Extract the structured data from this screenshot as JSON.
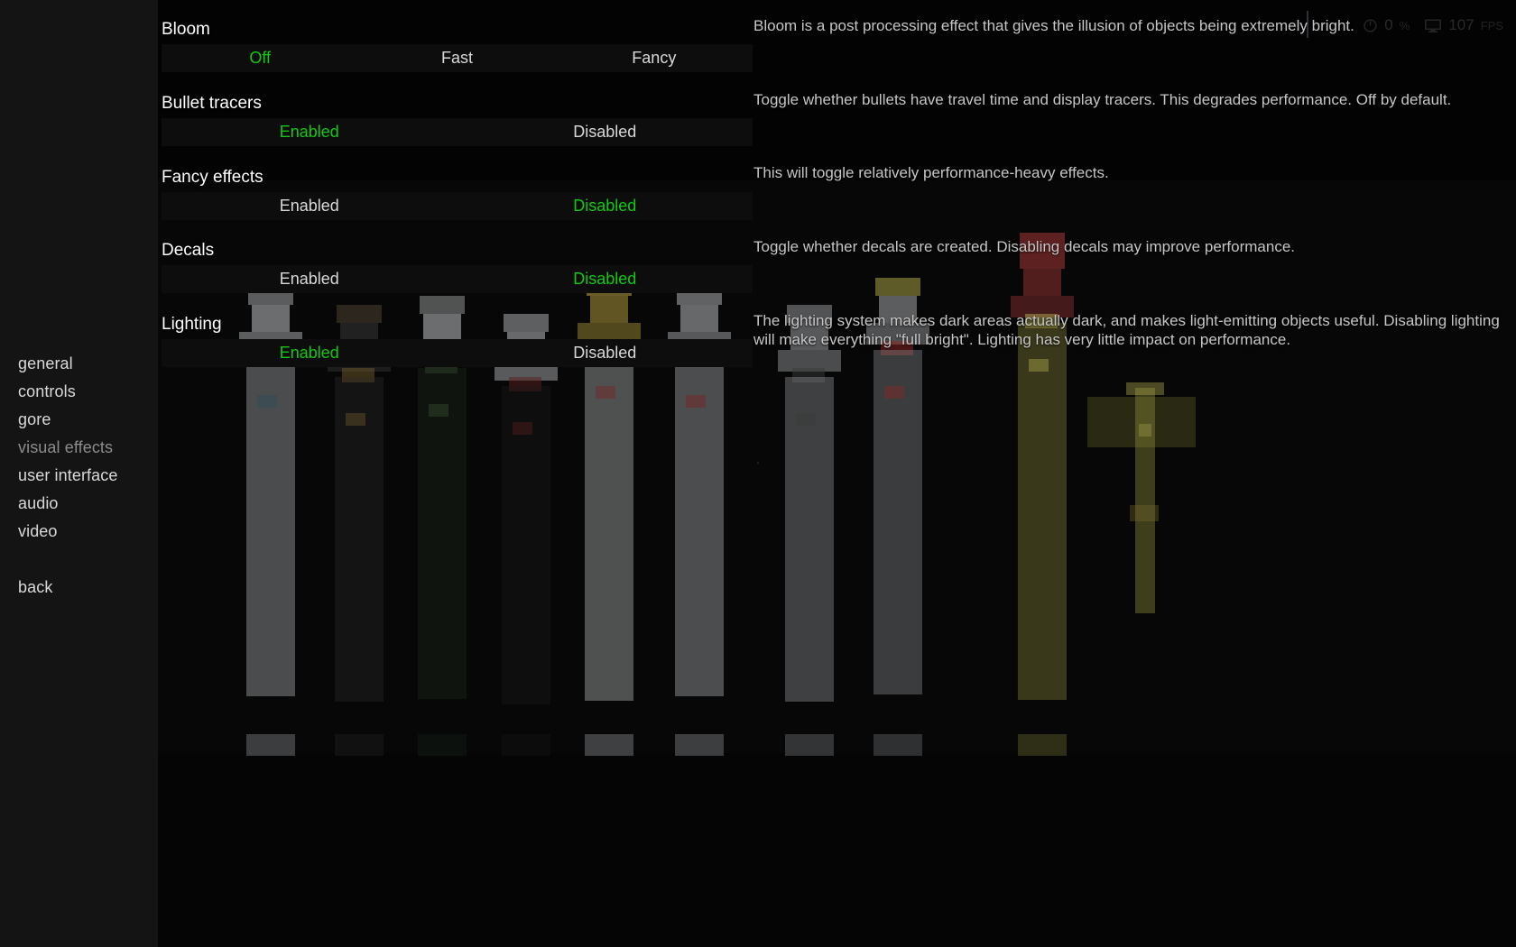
{
  "menu": {
    "items": [
      {
        "label": "general",
        "name": "general",
        "dim": false
      },
      {
        "label": "controls",
        "name": "controls",
        "dim": false
      },
      {
        "label": "gore",
        "name": "gore",
        "dim": false
      },
      {
        "label": "visual effects",
        "name": "visual-effects",
        "dim": true
      },
      {
        "label": "user interface",
        "name": "user-interface",
        "dim": false
      },
      {
        "label": "audio",
        "name": "audio",
        "dim": false
      },
      {
        "label": "video",
        "name": "video",
        "dim": false
      }
    ],
    "back_label": "back"
  },
  "colors": {
    "selected": "#12c912",
    "option_text": "#d9d9d9",
    "label_text": "#ffffff",
    "description_text": "#c6c6c6",
    "panel_bg": "#141414",
    "option_bar_bg": "#0d0d0d"
  },
  "settings": [
    {
      "label": "Bloom",
      "name": "bloom",
      "options": [
        "Off",
        "Fast",
        "Fancy"
      ],
      "selected_index": 0,
      "description": "Bloom is a post processing effect that gives the illusion of objects being extremely bright."
    },
    {
      "label": "Bullet tracers",
      "name": "bullet-tracers",
      "options": [
        "Enabled",
        "Disabled"
      ],
      "selected_index": 0,
      "description": "Toggle whether bullets have travel time and display tracers. This degrades performance. Off by default."
    },
    {
      "label": "Fancy effects",
      "name": "fancy-effects",
      "options": [
        "Enabled",
        "Disabled"
      ],
      "selected_index": 1,
      "description": "This will toggle relatively performance-heavy effects."
    },
    {
      "label": "Decals",
      "name": "decals",
      "options": [
        "Enabled",
        "Disabled"
      ],
      "selected_index": 1,
      "description": "Toggle whether decals are created. Disabling decals may improve performance."
    },
    {
      "label": "Lighting",
      "name": "lighting",
      "options": [
        "Enabled",
        "Disabled"
      ],
      "selected_index": 0,
      "description": "The lighting system makes dark areas actually dark, and makes light-emitting objects useful. Disabling lighting will make everything \"full bright\". Lighting has very little impact on performance."
    }
  ],
  "hud": {
    "load_value": "0",
    "load_unit": "%",
    "fps_value": "107",
    "fps_unit": "FPS"
  }
}
